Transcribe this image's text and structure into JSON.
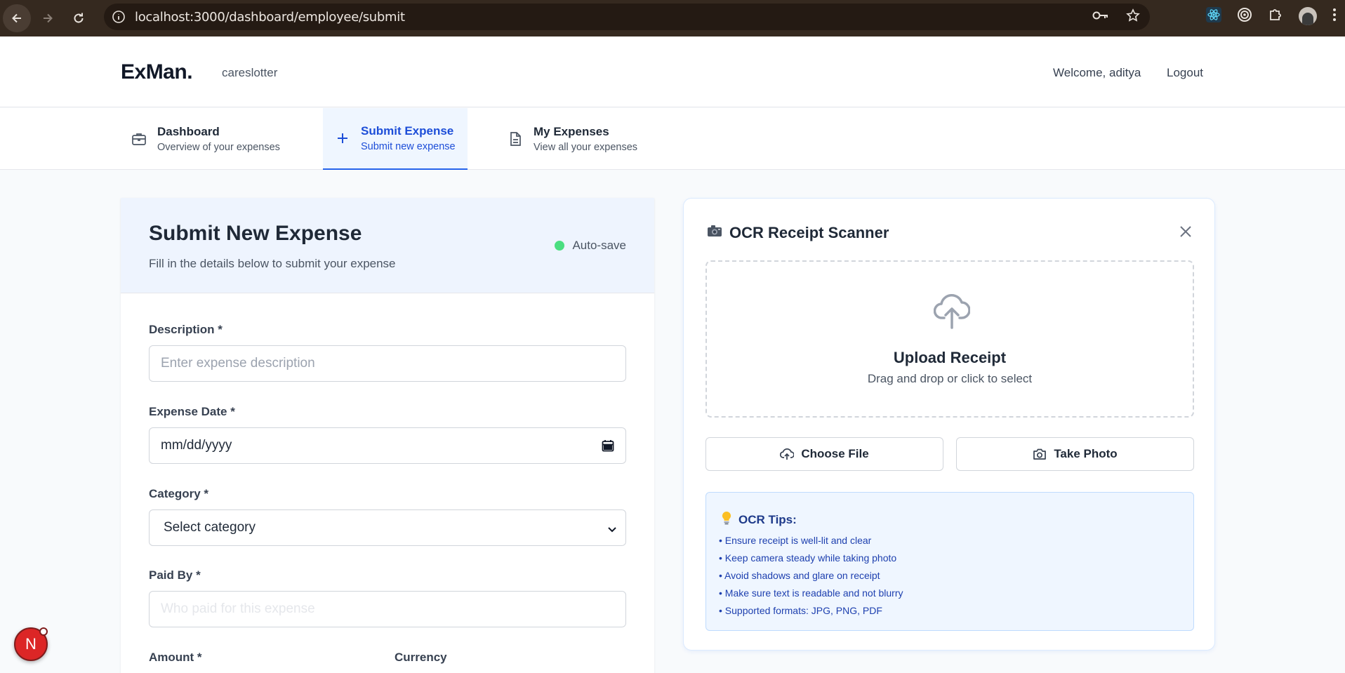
{
  "browser": {
    "url": "localhost:3000/dashboard/employee/submit"
  },
  "header": {
    "brand": "ExMan.",
    "organization": "careslotter",
    "welcome": "Welcome, aditya",
    "logout": "Logout"
  },
  "tabs": [
    {
      "label": "Dashboard",
      "sub": "Overview of your expenses",
      "icon": "briefcase-icon",
      "active": false
    },
    {
      "label": "Submit Expense",
      "sub": "Submit new expense",
      "icon": "plus-icon",
      "active": true
    },
    {
      "label": "My Expenses",
      "sub": "View all your expenses",
      "icon": "document-icon",
      "active": false
    }
  ],
  "form": {
    "title": "Submit New Expense",
    "subtitle": "Fill in the details below to submit your expense",
    "autosave": "Auto-save",
    "description": {
      "label": "Description *",
      "placeholder": "Enter expense description"
    },
    "date": {
      "label": "Expense Date *",
      "value": "mm/dd/yyyy"
    },
    "category": {
      "label": "Category *",
      "selected": "Select category"
    },
    "paid_by": {
      "label": "Paid By *",
      "placeholder": "Who paid for this expense"
    },
    "amount": {
      "label": "Amount *"
    },
    "currency": {
      "label": "Currency"
    }
  },
  "ocr": {
    "title": "OCR Receipt Scanner",
    "upload_title": "Upload Receipt",
    "upload_sub": "Drag and drop or click to select",
    "choose_file": "Choose File",
    "take_photo": "Take Photo",
    "tips_title": "OCR Tips:",
    "tips": [
      "• Ensure receipt is well-lit and clear",
      "• Keep camera steady while taking photo",
      "• Avoid shadows and glare on receipt",
      "• Make sure text is readable and not blurry",
      "• Supported formats: JPG, PNG, PDF"
    ]
  },
  "dev_indicator": {
    "letter": "N"
  },
  "colors": {
    "accent": "#2563eb",
    "autosave_dot": "#4ade80",
    "tips_bg": "#eff6ff",
    "dev_badge": "#dc2626"
  }
}
